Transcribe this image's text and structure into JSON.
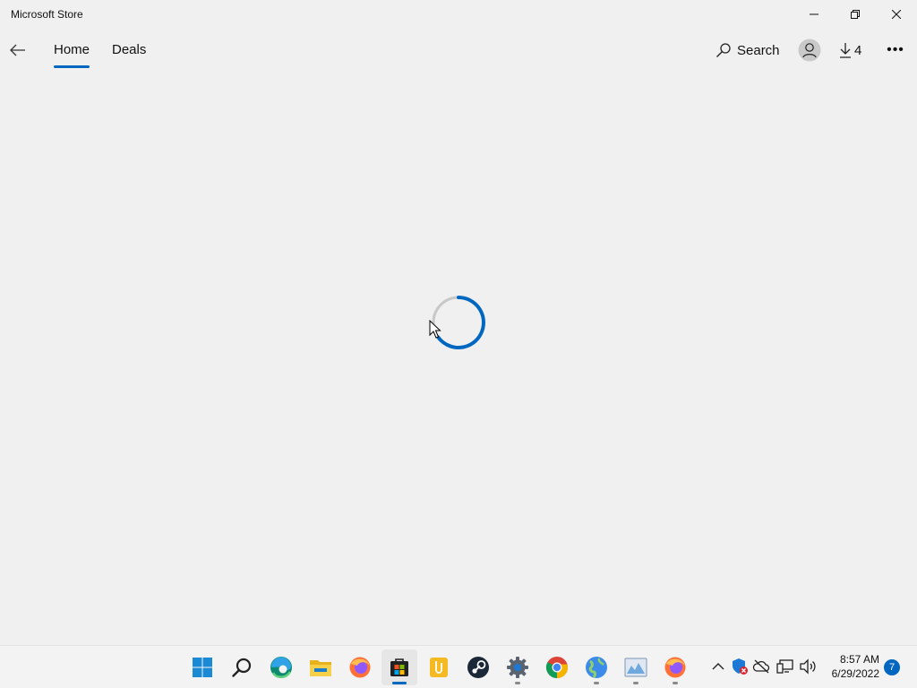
{
  "window": {
    "title": "Microsoft Store"
  },
  "nav": {
    "tabs": [
      {
        "label": "Home",
        "active": true
      },
      {
        "label": "Deals",
        "active": false
      }
    ],
    "search_label": "Search",
    "downloads_count": "4",
    "more_label": "•••"
  },
  "content": {
    "state": "loading"
  },
  "taskbar": {
    "apps": [
      {
        "name": "start",
        "icon": "windows-logo-icon"
      },
      {
        "name": "search",
        "icon": "search-icon"
      },
      {
        "name": "edge",
        "icon": "edge-icon"
      },
      {
        "name": "file-explorer",
        "icon": "folder-icon"
      },
      {
        "name": "firefox",
        "icon": "firefox-icon"
      },
      {
        "name": "microsoft-store",
        "icon": "store-icon",
        "active": true
      },
      {
        "name": "notes",
        "icon": "notes-icon"
      },
      {
        "name": "steam",
        "icon": "steam-icon"
      },
      {
        "name": "settings",
        "icon": "gear-icon"
      },
      {
        "name": "chrome",
        "icon": "chrome-icon"
      },
      {
        "name": "globe-app",
        "icon": "globe-icon"
      },
      {
        "name": "image-viewer",
        "icon": "image-icon"
      },
      {
        "name": "firefox-2",
        "icon": "firefox-icon"
      }
    ],
    "clock_time": "8:57 AM",
    "clock_date": "6/29/2022",
    "notification_count": "7"
  },
  "colors": {
    "accent": "#0067c0",
    "background": "#f0f0f0",
    "spinner_track": "#c8c8c8"
  }
}
